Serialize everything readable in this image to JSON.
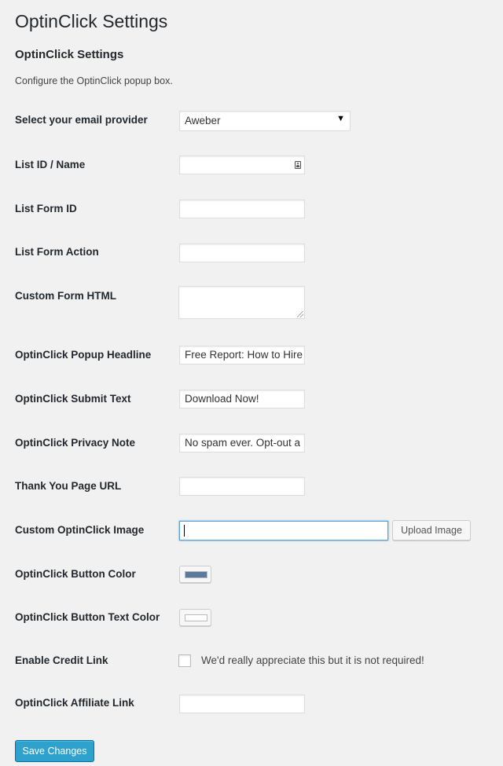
{
  "page": {
    "title": "OptinClick Settings",
    "section_title": "OptinClick Settings",
    "description": "Configure the OptinClick popup box."
  },
  "fields": {
    "email_provider": {
      "label": "Select your email provider",
      "value": "Aweber",
      "arrow_icon": "▼"
    },
    "list_id": {
      "label": "List ID / Name",
      "value": ""
    },
    "list_form_id": {
      "label": "List Form ID",
      "value": ""
    },
    "list_form_action": {
      "label": "List Form Action",
      "value": ""
    },
    "custom_form_html": {
      "label": "Custom Form HTML",
      "value": ""
    },
    "popup_headline": {
      "label": "OptinClick Popup Headline",
      "value": "Free Report: How to Hire"
    },
    "submit_text": {
      "label": "OptinClick Submit Text",
      "value": "Download Now!"
    },
    "privacy_note": {
      "label": "OptinClick Privacy Note",
      "value": "No spam ever. Opt-out a"
    },
    "thank_you_url": {
      "label": "Thank You Page URL",
      "value": ""
    },
    "custom_image": {
      "label": "Custom OptinClick Image",
      "value": "",
      "upload_label": "Upload Image"
    },
    "button_color": {
      "label": "OptinClick Button Color",
      "color": "#5b7a9e"
    },
    "button_text_color": {
      "label": "OptinClick Button Text Color",
      "color": "#ffffff"
    },
    "credit_link": {
      "label": "Enable Credit Link",
      "checked": false,
      "text": "We'd really appreciate this but it is not required!"
    },
    "affiliate_link": {
      "label": "OptinClick Affiliate Link",
      "value": ""
    }
  },
  "actions": {
    "save_label": "Save Changes"
  },
  "colors": {
    "primary_button": "#2ea2cc",
    "background": "#f1f1f1",
    "focus_border": "#5b9dd9"
  }
}
